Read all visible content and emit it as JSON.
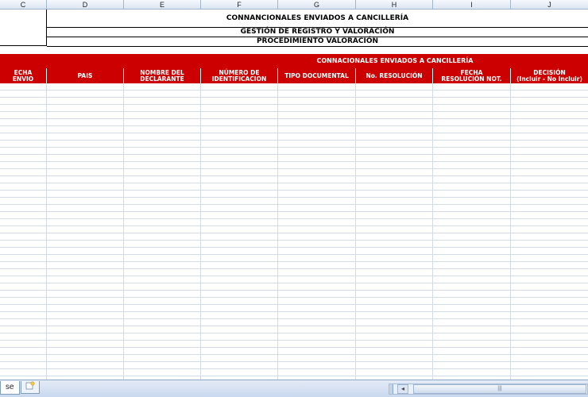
{
  "columns": {
    "C": "C",
    "D": "D",
    "E": "E",
    "F": "F",
    "G": "G",
    "H": "H",
    "I": "I",
    "J": "J"
  },
  "title": {
    "main": "CONNANCIONALES ENVIADOS A CANCILLERÍA",
    "sub1": "GESTIÓN DE REGISTRO Y VALORACIÓN",
    "sub2": "PROCEDIMIENTO VALORACIÓN"
  },
  "banner": "CONNACIONALES ENVIADOS A CANCILLERÍA",
  "headers": {
    "fecha_envio": "ECHA\nENVIO",
    "pais": "PAIS",
    "nombre": "NOMBRE DEL\nDECLARANTE",
    "numero": "NÚMERO DE\nIDENTIFICACION",
    "tipo": "TIPO DOCUMENTAL",
    "resolucion": "No. RESOLUCIÓN",
    "fecha_resolucion": "FECHA\nRESOLUCIÓN NOT.",
    "decision": "DECISIÓN\n(Incluir - No Incluir)"
  },
  "tabs": {
    "sheet_label": "se",
    "new_sheet_icon": "new-sheet-icon"
  },
  "scrollbar": {
    "left_arrow": "◂",
    "thumb_grip": "|||"
  },
  "colors": {
    "header_red": "#cc0000",
    "grid_line": "#d4dbe6"
  }
}
